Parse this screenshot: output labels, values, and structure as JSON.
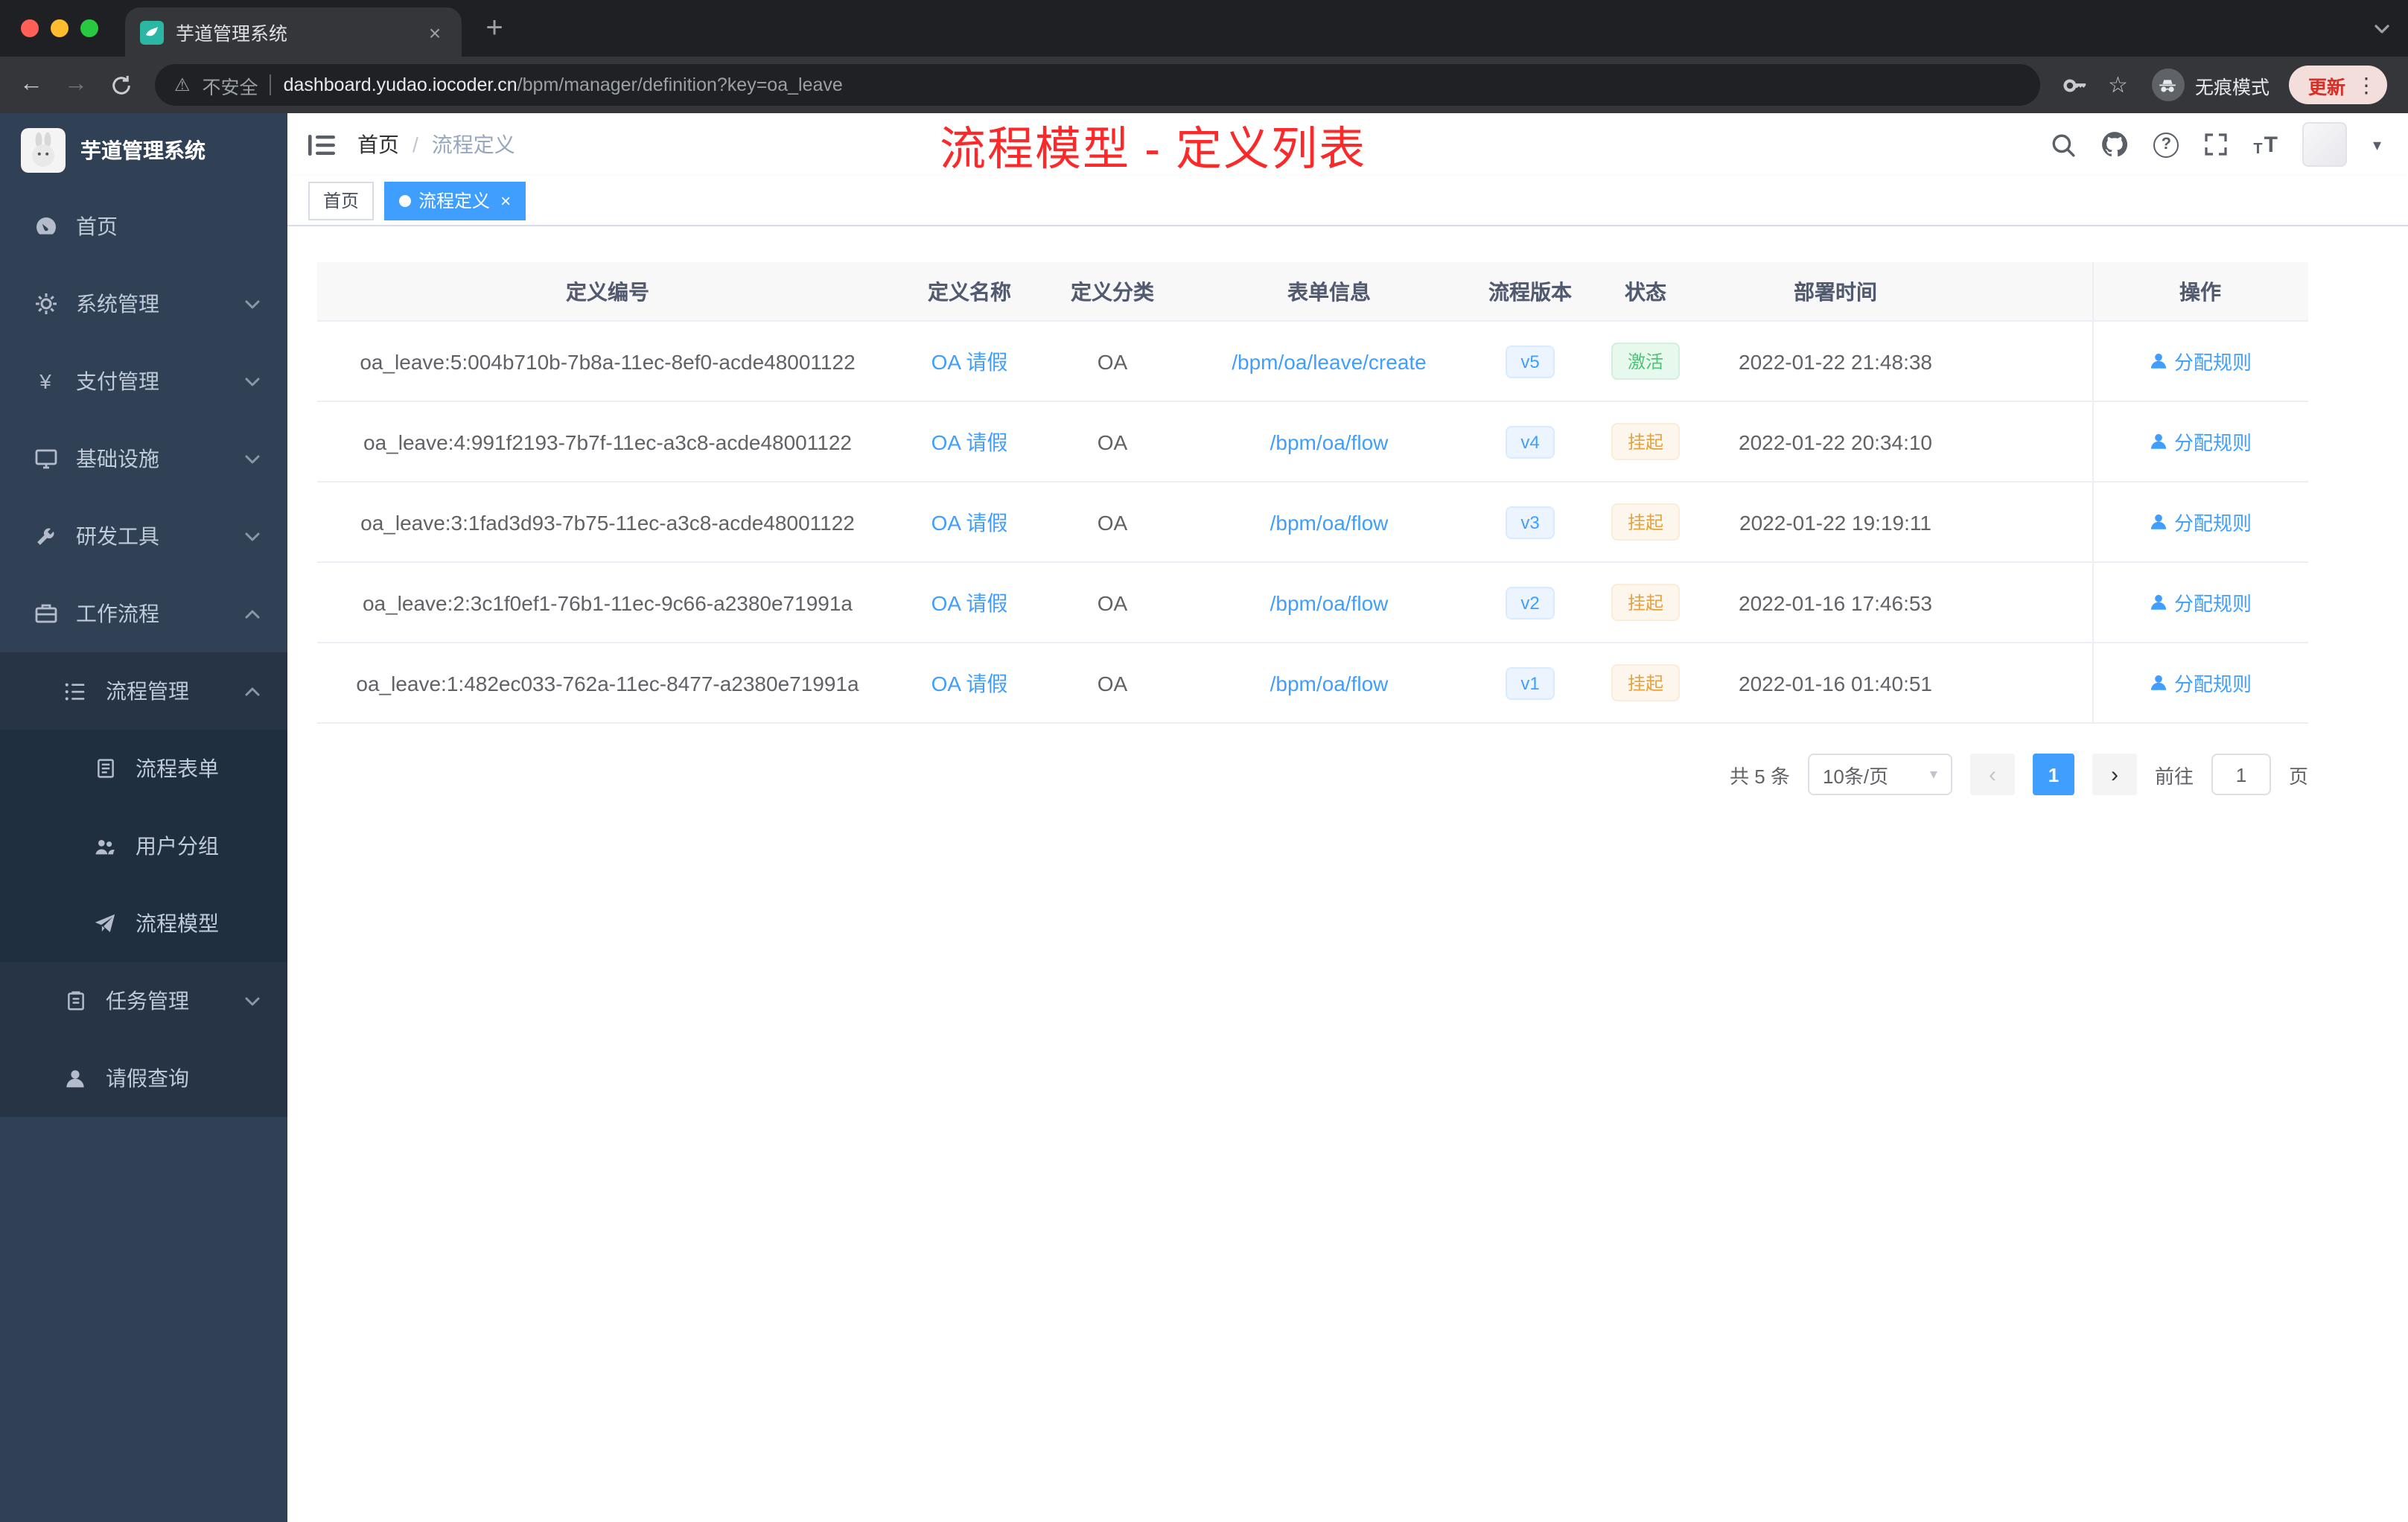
{
  "browser": {
    "tab_title": "芋道管理系统",
    "security_label": "不安全",
    "url_host": "dashboard.yudao.iocoder.cn",
    "url_path": "/bpm/manager/definition?key=oa_leave",
    "incognito_label": "无痕模式",
    "update_label": "更新"
  },
  "icons": {
    "close": "×",
    "plus": "+",
    "back": "←",
    "forward": "→",
    "warning": "⚠",
    "star": "☆",
    "kebab": "⋮",
    "caret_down": "▾",
    "slash": "/",
    "prev": "‹",
    "next": "›",
    "help": "?",
    "yen": "¥",
    "text_t": "T"
  },
  "sidebar": {
    "logo_title": "芋道管理系统",
    "items": {
      "home": "首页",
      "system": "系统管理",
      "payment": "支付管理",
      "infra": "基础设施",
      "devtools": "研发工具",
      "workflow": "工作流程",
      "process_mgmt": "流程管理",
      "process_form": "流程表单",
      "user_group": "用户分组",
      "process_model": "流程模型",
      "task_mgmt": "任务管理",
      "leave_query": "请假查询"
    }
  },
  "header": {
    "breadcrumb_home": "首页",
    "breadcrumb_current": "流程定义",
    "annotation": "流程模型 - 定义列表"
  },
  "tags": {
    "home": "首页",
    "current": "流程定义"
  },
  "table": {
    "columns": [
      "定义编号",
      "定义名称",
      "定义分类",
      "表单信息",
      "流程版本",
      "状态",
      "部署时间",
      "操作"
    ],
    "rows": [
      {
        "id": "oa_leave:5:004b710b-7b8a-11ec-8ef0-acde48001122",
        "name": "OA 请假",
        "category": "OA",
        "form": "/bpm/oa/leave/create",
        "version": "v5",
        "status": "激活",
        "deploy_time": "2022-01-22 21:48:38",
        "action": "分配规则"
      },
      {
        "id": "oa_leave:4:991f2193-7b7f-11ec-a3c8-acde48001122",
        "name": "OA 请假",
        "category": "OA",
        "form": "/bpm/oa/flow",
        "version": "v4",
        "status": "挂起",
        "deploy_time": "2022-01-22 20:34:10",
        "action": "分配规则"
      },
      {
        "id": "oa_leave:3:1fad3d93-7b75-11ec-a3c8-acde48001122",
        "name": "OA 请假",
        "category": "OA",
        "form": "/bpm/oa/flow",
        "version": "v3",
        "status": "挂起",
        "deploy_time": "2022-01-22 19:19:11",
        "action": "分配规则"
      },
      {
        "id": "oa_leave:2:3c1f0ef1-76b1-11ec-9c66-a2380e71991a",
        "name": "OA 请假",
        "category": "OA",
        "form": "/bpm/oa/flow",
        "version": "v2",
        "status": "挂起",
        "deploy_time": "2022-01-16 17:46:53",
        "action": "分配规则"
      },
      {
        "id": "oa_leave:1:482ec033-762a-11ec-8477-a2380e71991a",
        "name": "OA 请假",
        "category": "OA",
        "form": "/bpm/oa/flow",
        "version": "v1",
        "status": "挂起",
        "deploy_time": "2022-01-16 01:40:51",
        "action": "分配规则"
      }
    ]
  },
  "pagination": {
    "total": "共 5 条",
    "page_size": "10条/页",
    "page": "1",
    "goto_label": "前往",
    "goto_page": "1",
    "page_unit": "页"
  },
  "colors": {
    "accent": "#409eff",
    "success": "#67c23a",
    "warning": "#e6a23c",
    "annotation": "#fb2a2a",
    "sidebar_bg": "#304156"
  }
}
